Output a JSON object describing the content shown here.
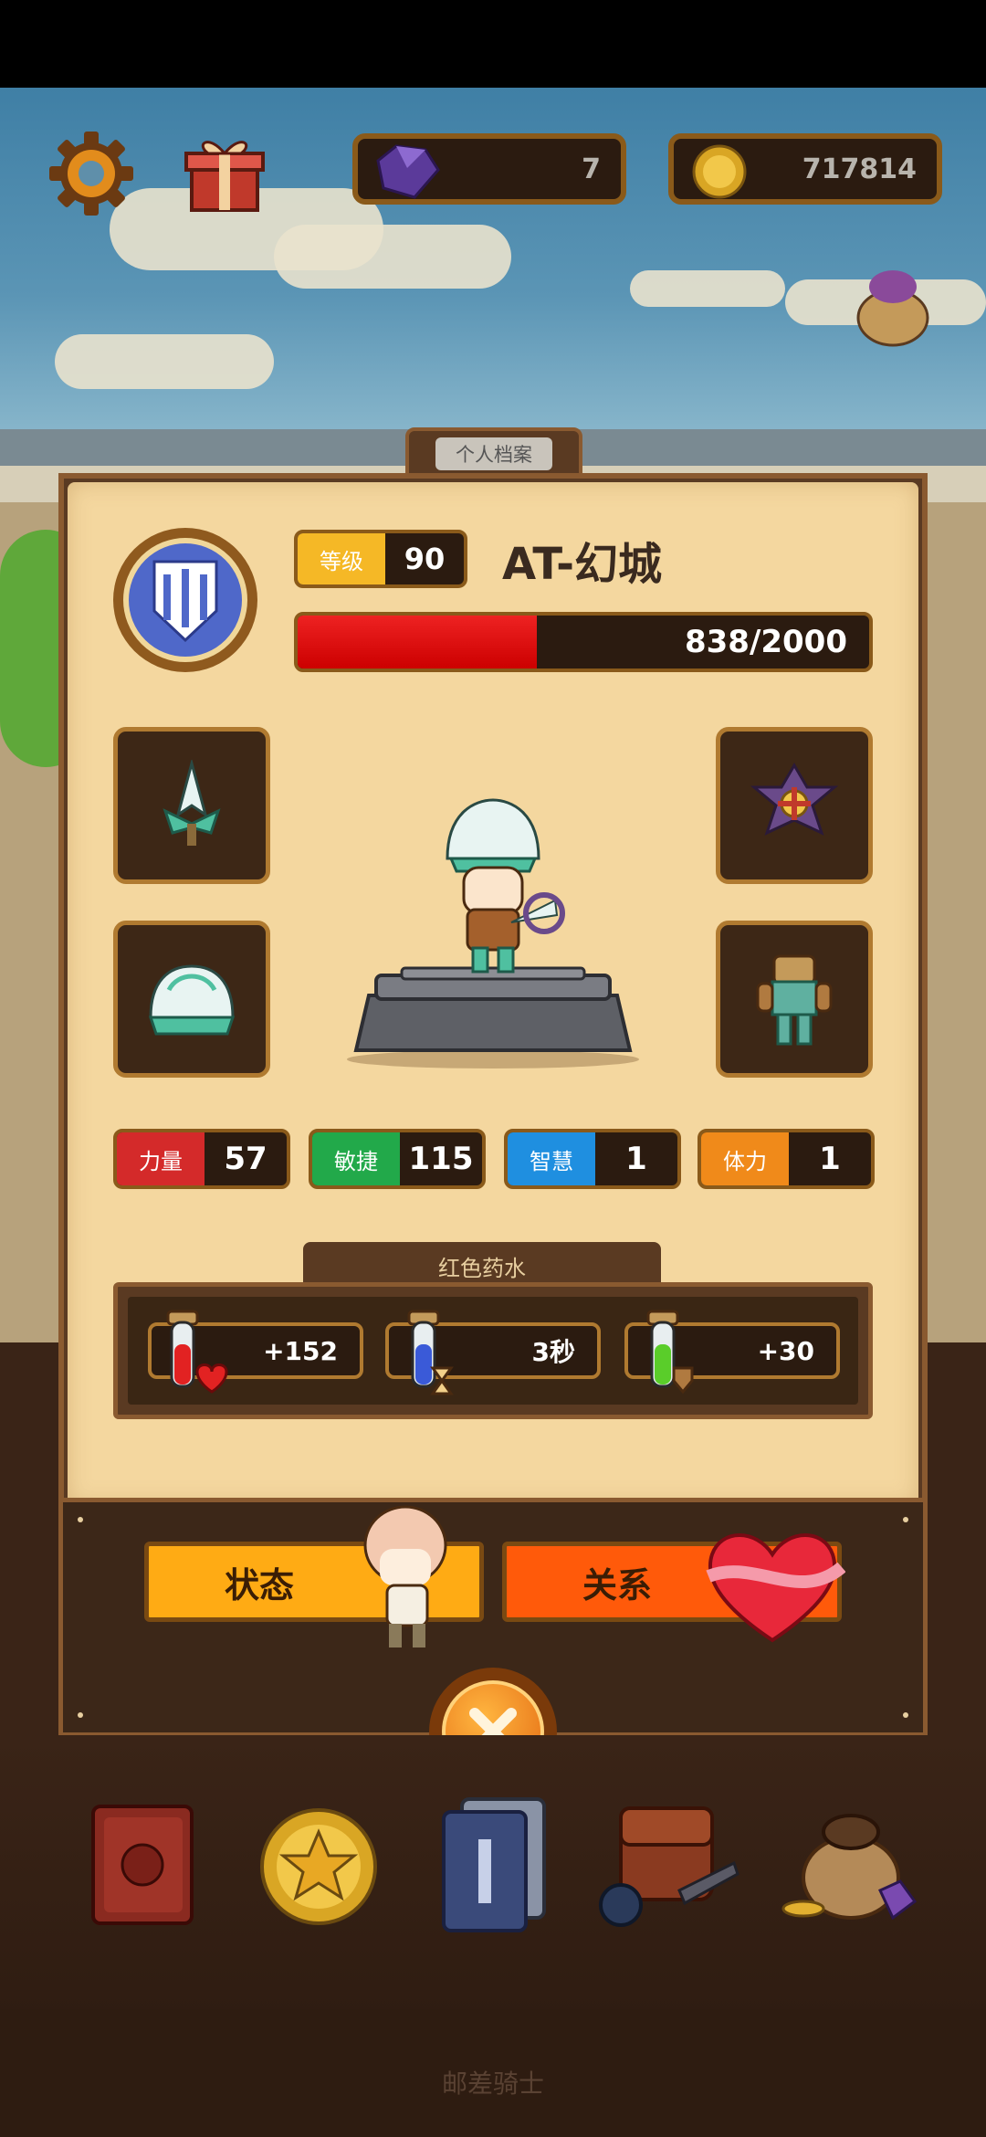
{
  "top_bar": {
    "settings_icon": "gear-icon",
    "gift_icon": "gift-box-icon",
    "gems": {
      "icon": "purple-gem-icon",
      "value": "7"
    },
    "coins": {
      "icon": "gold-coin-icon",
      "value": "717814"
    },
    "bag_icon": "purple-pouch-icon"
  },
  "profile": {
    "tab_title": "个人档案",
    "level_label": "等级",
    "level_value": "90",
    "player_name": "AT-幻城",
    "hp_text": "838/2000",
    "hp_fraction": 0.419,
    "equipment": [
      {
        "name": "weapon-slot",
        "icon": "jade-spear-tip-icon"
      },
      {
        "name": "accessory-slot",
        "icon": "purple-shield-charm-icon"
      },
      {
        "name": "helmet-slot",
        "icon": "jade-helmet-icon"
      },
      {
        "name": "armor-slot",
        "icon": "leather-armor-icon"
      }
    ],
    "stats": [
      {
        "label": "力量",
        "value": "57",
        "color": "#d42a2a"
      },
      {
        "label": "敏捷",
        "value": "115",
        "color": "#22a94a"
      },
      {
        "label": "智慧",
        "value": "1",
        "color": "#1f8fe0"
      },
      {
        "label": "体力",
        "value": "1",
        "color": "#f08a1a"
      }
    ]
  },
  "potion": {
    "title": "红色药水",
    "items": [
      {
        "value": "+152",
        "icon": "red-potion-heart-icon"
      },
      {
        "value": "3秒",
        "icon": "blue-potion-hourglass-icon"
      },
      {
        "value": "+30",
        "icon": "green-potion-shield-icon"
      }
    ]
  },
  "actions": {
    "status_label": "状态",
    "relation_label": "关系",
    "close_icon": "close-x-icon"
  },
  "bottom_nav": [
    {
      "icon": "book-icon"
    },
    {
      "icon": "star-coin-icon"
    },
    {
      "icon": "card-deck-icon"
    },
    {
      "icon": "backpack-icon"
    },
    {
      "icon": "treasure-bag-icon"
    }
  ],
  "footer_title": "邮差骑士",
  "colors": {
    "hp_red": "#e22222",
    "status_button": "#ffab14",
    "relation_button": "#ff5a0a",
    "level_badge": "#f5b826"
  }
}
